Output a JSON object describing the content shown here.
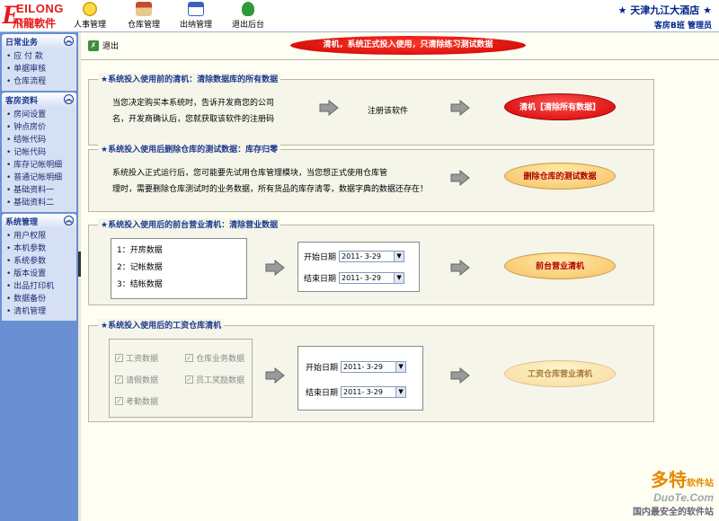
{
  "logo": {
    "en": "EILONG",
    "cn": "飛龍軟件"
  },
  "toolbar": [
    {
      "label": "人事管理",
      "icon": "smiley-icon"
    },
    {
      "label": "仓库管理",
      "icon": "warehouse-icon"
    },
    {
      "label": "出纳管理",
      "icon": "calendar-icon"
    },
    {
      "label": "退出后台",
      "icon": "runner-icon"
    }
  ],
  "hotel": {
    "name": "天津九江大酒店",
    "sub": "客房B班  管理员"
  },
  "sidebar": [
    {
      "title": "日常业务",
      "items": [
        "应 付 款",
        "单据审核",
        "仓库流程"
      ]
    },
    {
      "title": "客房资料",
      "items": [
        "房间设置",
        "钟点房价",
        "结帐代码",
        "记帐代码",
        "库存记帐明细",
        "普通记帐明细",
        "基础资料一",
        "基础资料二"
      ]
    },
    {
      "title": "系统管理",
      "items": [
        "用户权限",
        "本机参数",
        "系统参数",
        "版本设置",
        "出品打印机",
        "数据备份",
        "清机管理"
      ]
    }
  ],
  "main": {
    "exit_label": "退出",
    "banner": "清机，系统正式投入使用，只清除练习测试数据",
    "panel1": {
      "title": "★系统投入使用前的清机：清除数据库的所有数据",
      "line1": "当您决定购买本系统时，告诉开发商您的公司",
      "line2": "名，开发商确认后，您就获取该软件的注册码",
      "mid": "注册该软件",
      "button": "清机【清除所有数据】"
    },
    "panel2": {
      "title": "★系统投入使用后删除仓库的测试数据：库存归零",
      "line1": "系统投入正式运行后，您可能要先试用仓库管理模块，当您想正式使用仓库管",
      "line2": "理时，需要删除仓库测试时的业务数据，所有货品的库存清零，数据字典的数据还存在！",
      "button": "删除仓库的测试数据"
    },
    "panel3": {
      "title": "★系统投入使用后的前台营业清机：清除营业数据",
      "items": [
        "1：开房数据",
        "2：记帐数据",
        "3：结帐数据"
      ],
      "start_label": "开始日期",
      "start_value": "2011- 3-29",
      "end_label": "结束日期",
      "end_value": "2011- 3-29",
      "button": "前台营业清机"
    },
    "panel4": {
      "title": "★系统投入使用后的工资仓库清机",
      "checks": [
        "工资数据",
        "仓库业务数据",
        "请假数据",
        "员工奖励数据",
        "考勤数据"
      ],
      "start_label": "开始日期",
      "start_value": "2011- 3-29",
      "end_label": "结束日期",
      "end_value": "2011- 3-29",
      "button": "工资仓库营业清机"
    }
  },
  "watermark": {
    "big": "www.DuoTe.com",
    "brand1": "多特",
    "brand1_small": "软件站",
    "brand2": "DuoTe.Com",
    "brand3": "国内最安全的软件站"
  },
  "colors": {
    "sidebar": "#6a8fd3",
    "title": "#1c3a8c",
    "red_button": "#d20000",
    "orange_button": "#f7c262"
  }
}
